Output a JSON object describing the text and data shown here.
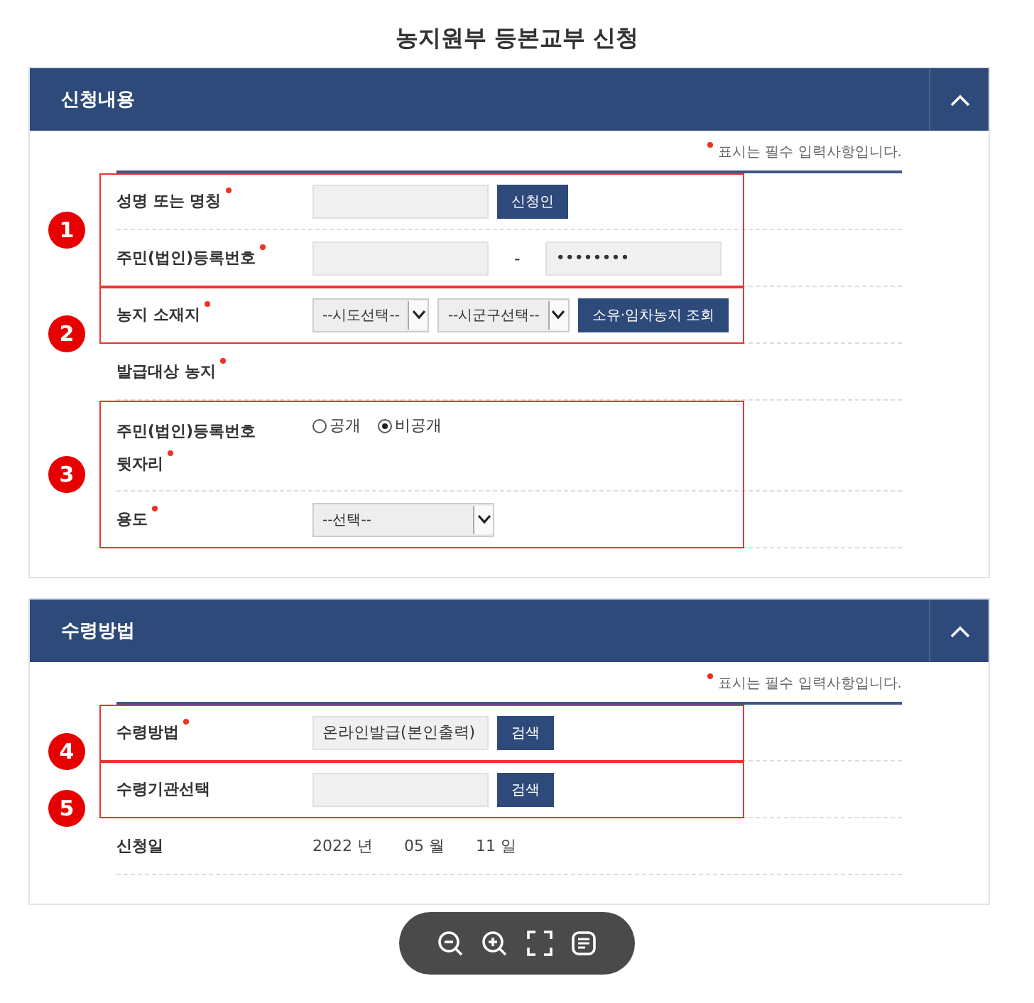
{
  "page_title": "농지원부 등본교부 신청",
  "sections": [
    {
      "title": "신청내용",
      "expanded": true,
      "required_note": "표시는 필수 입력사항입니다.",
      "groups": [
        {
          "marker": "1",
          "rows": [
            {
              "label": "성명 또는 명칭",
              "required": true,
              "controls": [
                {
                  "kind": "input"
                },
                {
                  "kind": "button",
                  "label": "신청인"
                }
              ]
            },
            {
              "label": "주민(법인)등록번호",
              "required": true,
              "controls": [
                {
                  "kind": "input"
                },
                {
                  "kind": "separator",
                  "label": "-"
                },
                {
                  "kind": "input",
                  "value": "••••••••"
                }
              ]
            }
          ]
        },
        {
          "marker": "2",
          "rows": [
            {
              "label": "농지 소재지",
              "required": true,
              "controls": [
                {
                  "kind": "select",
                  "label": "--시도선택--"
                },
                {
                  "kind": "select",
                  "label": "--시군구선택--"
                },
                {
                  "kind": "button",
                  "label": "소유·임차농지 조회"
                }
              ]
            }
          ]
        },
        {
          "rows": [
            {
              "label": "발급대상 농지",
              "required": true,
              "controls": []
            }
          ]
        },
        {
          "marker": "3",
          "rows": [
            {
              "label": "주민(법인)등록번호\n뒷자리",
              "required": true,
              "controls": [
                {
                  "kind": "radio",
                  "label": "공개",
                  "selected": false
                },
                {
                  "kind": "radio",
                  "label": "비공개",
                  "selected": true
                }
              ]
            },
            {
              "label": "용도",
              "required": true,
              "controls": [
                {
                  "kind": "select",
                  "label": "--선택--"
                }
              ]
            }
          ]
        }
      ]
    },
    {
      "title": "수령방법",
      "expanded": true,
      "required_note": "표시는 필수 입력사항입니다.",
      "groups": [
        {
          "marker": "4",
          "rows": [
            {
              "label": "수령방법",
              "required": true,
              "controls": [
                {
                  "kind": "input",
                  "value": "온라인발급(본인출력)"
                },
                {
                  "kind": "button",
                  "label": "검색"
                }
              ]
            }
          ]
        },
        {
          "marker": "5",
          "rows": [
            {
              "label": "수령기관선택",
              "required": false,
              "controls": [
                {
                  "kind": "input"
                },
                {
                  "kind": "button",
                  "label": "검색"
                }
              ]
            }
          ]
        },
        {
          "rows": [
            {
              "label": "신청일",
              "required": false,
              "controls": [
                {
                  "kind": "date",
                  "label": "2022 년"
                },
                {
                  "kind": "date",
                  "label": "05 월"
                },
                {
                  "kind": "date",
                  "label": "11 일"
                }
              ]
            }
          ]
        }
      ]
    }
  ]
}
